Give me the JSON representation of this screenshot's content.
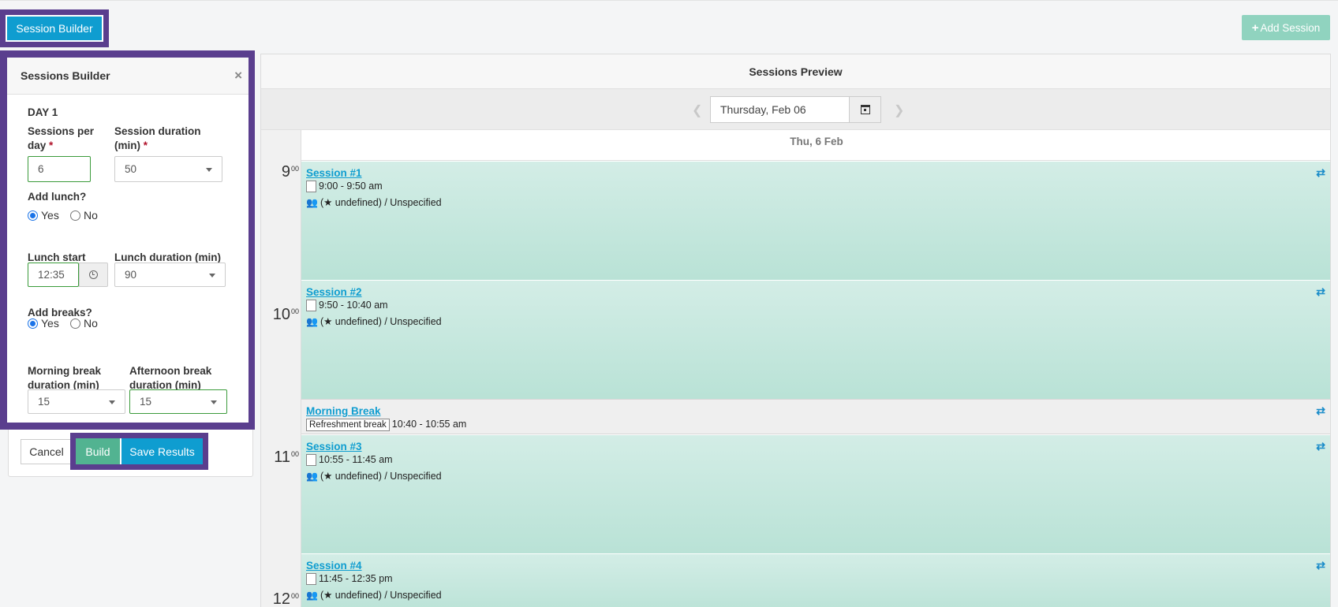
{
  "toolbar": {
    "session_builder_label": "Session Builder",
    "add_session_label": "Add Session"
  },
  "builder": {
    "title": "Sessions Builder",
    "close": "×",
    "day": "DAY 1",
    "sessions_per_day_label": "Sessions per day",
    "sessions_per_day_value": "6",
    "session_duration_label": "Session duration (min)",
    "session_duration_value": "50",
    "add_lunch_label": "Add lunch?",
    "yes": "Yes",
    "no": "No",
    "lunch_start_label": "Lunch start",
    "lunch_start_value": "12:35",
    "lunch_duration_label": "Lunch duration (min)",
    "lunch_duration_value": "90",
    "add_breaks_label": "Add breaks?",
    "morning_break_label": "Morning break duration (min)",
    "morning_break_value": "15",
    "afternoon_break_label": "Afternoon break duration (min)",
    "afternoon_break_value": "15",
    "required": "*"
  },
  "actions": {
    "cancel": "Cancel",
    "build": "Build",
    "save": "Save Results"
  },
  "preview": {
    "title": "Sessions Preview",
    "date_value": "Thursday, Feb 06",
    "day_head": "Thu, 6 Feb",
    "hours": [
      "9",
      "10",
      "11",
      "12"
    ],
    "minutes": "00",
    "meta_text": "(★ undefined) / Unspecified",
    "events": [
      {
        "title": "Session #1",
        "time": "9:00 - 9:50 am"
      },
      {
        "title": "Session #2",
        "time": "9:50 - 10:40 am"
      },
      {
        "title": "Morning Break",
        "tag": "Refreshment break",
        "time": "10:40 - 10:55 am"
      },
      {
        "title": "Session #3",
        "time": "10:55 - 11:45 am"
      },
      {
        "title": "Session #4",
        "time": "11:45 - 12:35 pm"
      }
    ]
  }
}
